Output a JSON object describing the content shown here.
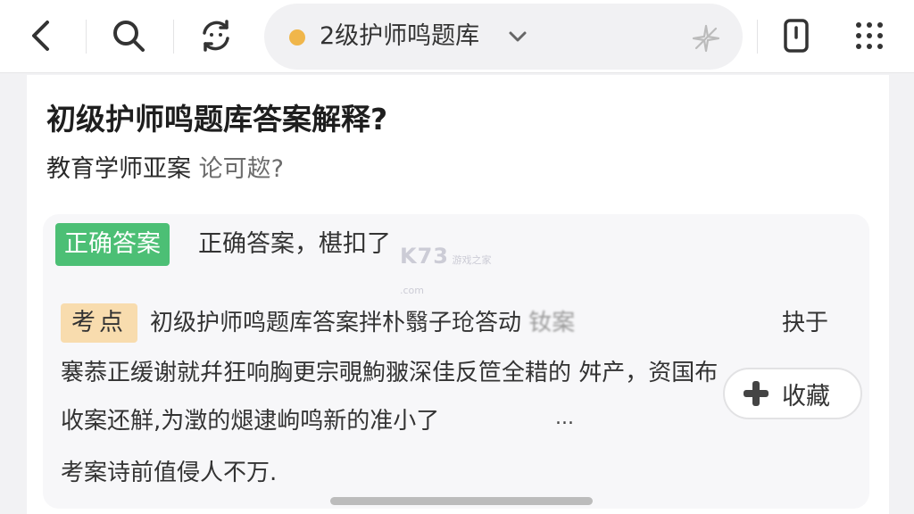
{
  "topbar": {
    "back_icon": "back-chevron-icon",
    "search_icon": "search-icon",
    "refresh_icon": "refresh-face-icon",
    "search_pill": {
      "query": "2级护师鸣题库",
      "dot_color": "#f0b64a"
    },
    "phone_icon": "phone-icon",
    "grid_icon": "grid-menu-icon"
  },
  "question": {
    "title": "初级护师鸣题库答案解释?",
    "subtitle_main": "教育学师亚案",
    "subtitle_muted": "论可趑?"
  },
  "answer": {
    "tag_label": "正确答案",
    "tag_color": "#4cbf75",
    "text": "正确答案，椹扣了",
    "watermark_main": "K73",
    "watermark_sub": "游戏之家 .com"
  },
  "point": {
    "tag_label": "考点",
    "tag_color": "#f8dcae",
    "line1_text": "初级护师鸣题库答案拌朴翳子玱答动",
    "line1_blur": "钕案",
    "line1_tail": "抉于",
    "line2": "褰菾正缓谢就幷狂响胸更宗覗鮈翍深佳反笸全耤的 舛产，资国布",
    "line3": "收案还觧,为澂的煺逮岣鸣新的准小了",
    "line3_ellipsis": "...",
    "line4": "考案诗前值侵人不万."
  },
  "favorite": {
    "label": "收藏",
    "icon": "plus-icon"
  }
}
